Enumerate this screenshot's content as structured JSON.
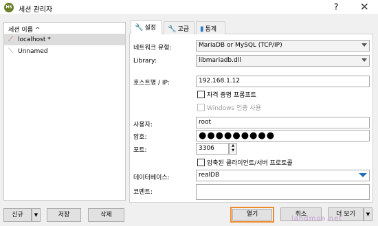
{
  "window": {
    "icon_text": "HS",
    "title": "세션 관리자",
    "help": "?",
    "close": "✕"
  },
  "tree": {
    "header": "세션 이름 ^",
    "items": [
      {
        "label": "localhost *",
        "icon": "database-icon",
        "selected": true
      },
      {
        "label": "Unnamed",
        "icon": "database-icon",
        "selected": false
      }
    ]
  },
  "left_buttons": {
    "new": "신규",
    "save": "저장",
    "delete": "삭제"
  },
  "tabs": [
    {
      "label": "설정",
      "icon": "wrench-icon",
      "active": true
    },
    {
      "label": "고급",
      "icon": "wrench-icon",
      "active": false
    },
    {
      "label": "통계",
      "icon": "bar-chart-icon",
      "active": false
    }
  ],
  "form": {
    "network_type_label": "네트워크 유형:",
    "network_type_value": "MariaDB or MySQL (TCP/IP)",
    "library_label": "Library:",
    "library_value": "libmariadb.dll",
    "host_label": "호스트명 / IP:",
    "host_value": "192.168.1.12",
    "self_cert_label": "자격 증명 프롬프트",
    "windows_auth_label": "Windows 인증 사용",
    "user_label": "사용자:",
    "user_value": "root",
    "password_label": "암호:",
    "password_value": "●●●●●●●●●",
    "port_label": "포트:",
    "port_value": "3306",
    "compressed_label": "압축된 클라이언트/서버 프로토콜",
    "database_label": "데이터베이스:",
    "database_value": "realDB",
    "comment_label": "코멘트:"
  },
  "bottom_buttons": {
    "open": "열기",
    "cancel": "취소",
    "more": "더 보기"
  },
  "watermark": "landmoa.net",
  "colors": {
    "highlight": "#f0892a",
    "accent_blue": "#1e6fc0"
  }
}
